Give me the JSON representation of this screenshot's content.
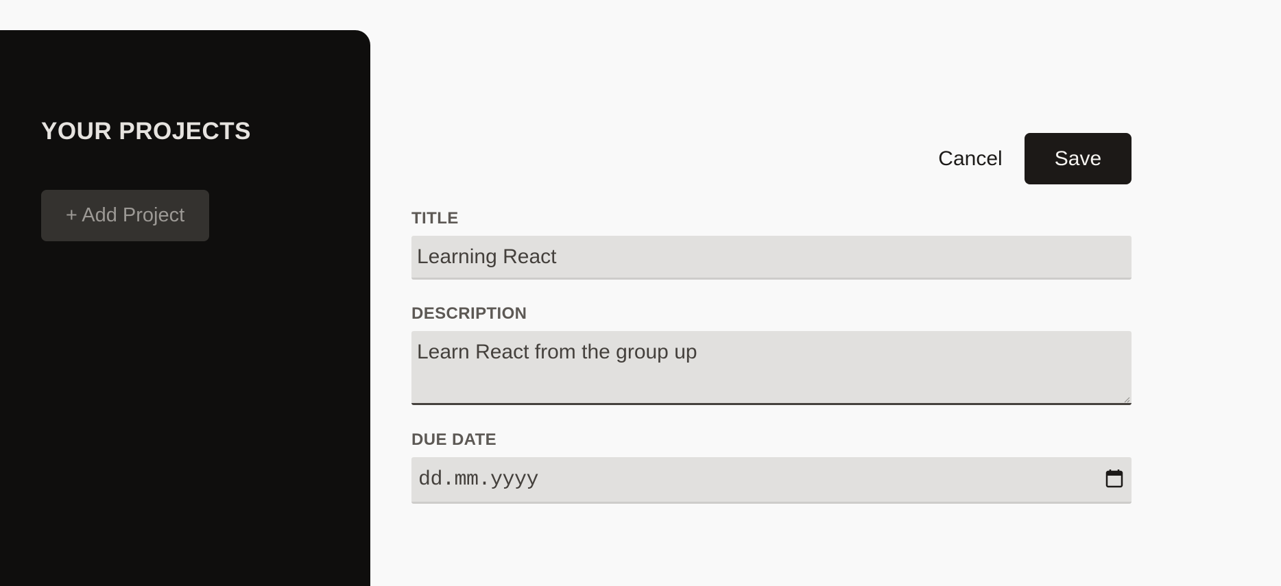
{
  "sidebar": {
    "title": "YOUR PROJECTS",
    "add_project_label": "+ Add Project"
  },
  "actions": {
    "cancel_label": "Cancel",
    "save_label": "Save"
  },
  "form": {
    "title_label": "TITLE",
    "title_value": "Learning React",
    "description_label": "DESCRIPTION",
    "description_value": "Learn React from the group up",
    "due_date_label": "DUE DATE",
    "due_date_placeholder": "dd.mm.yyyy"
  },
  "icons": {
    "calendar": "calendar-icon"
  },
  "colors": {
    "sidebar_bg": "#0f0e0d",
    "page_bg": "#f9f9f9",
    "save_bg": "#1c1917",
    "input_bg": "#e1e0de"
  }
}
